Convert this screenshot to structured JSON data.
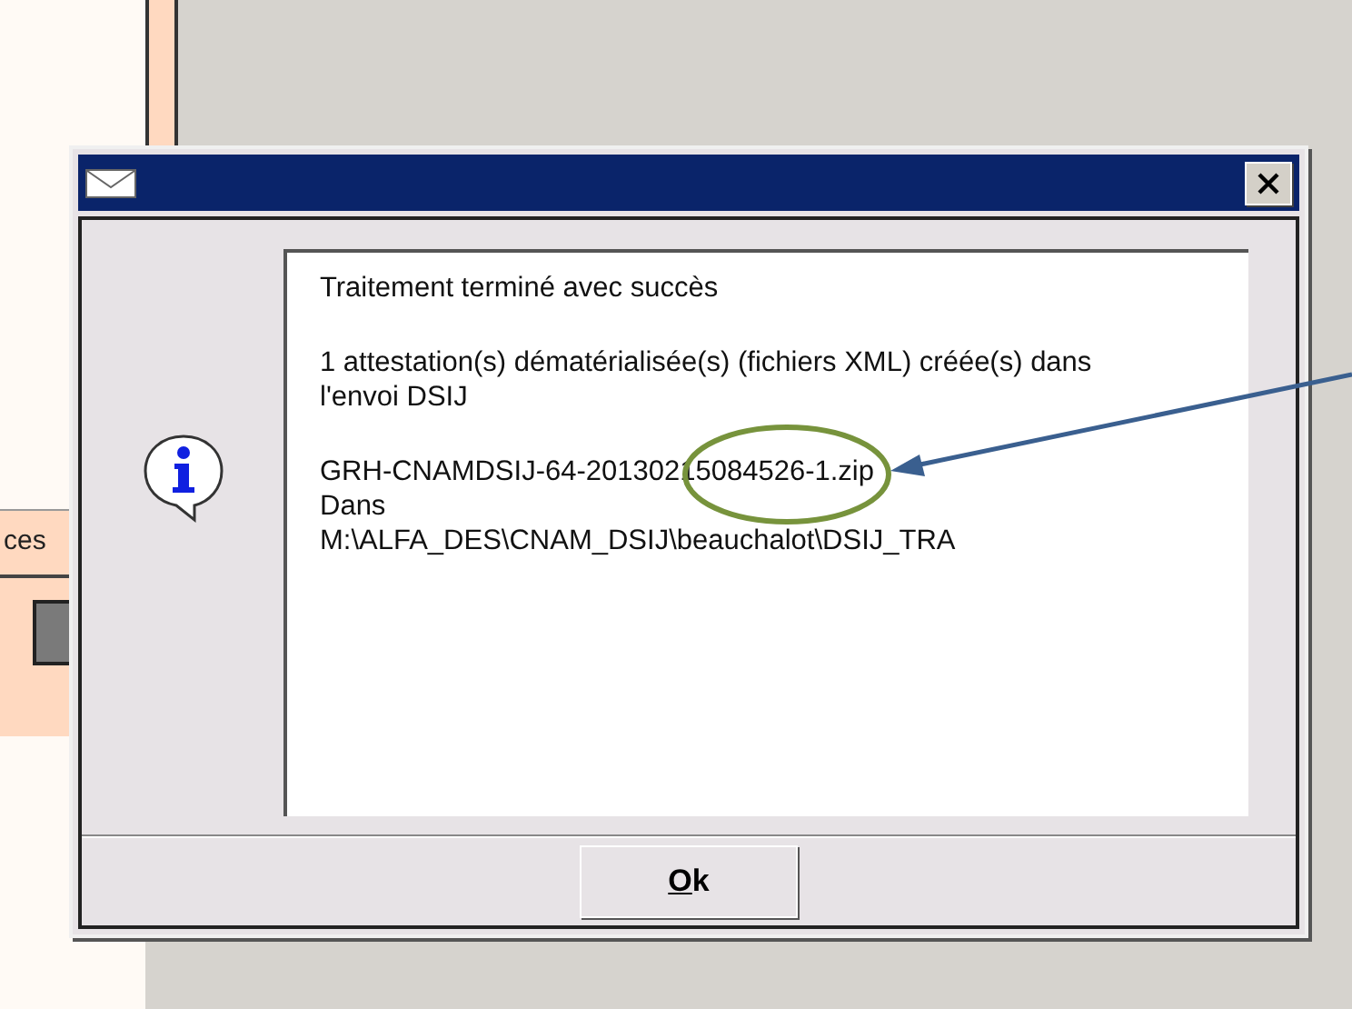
{
  "background_panel": {
    "label": "ces"
  },
  "dialog": {
    "paragraphs": [
      [
        "Traitement terminé avec succès"
      ],
      [
        "1 attestation(s) dématérialisée(s) (fichiers XML) créée(s) dans",
        "l'envoi DSIJ"
      ],
      [
        "GRH-CNAMDSIJ-64-20130215084526-1.zip",
        "Dans",
        "M:\\ALFA_DES\\CNAM_DSIJ\\beauchalot\\DSIJ_TRA"
      ]
    ],
    "button": {
      "label": "Ok",
      "mnemonic_underlined": true
    }
  }
}
